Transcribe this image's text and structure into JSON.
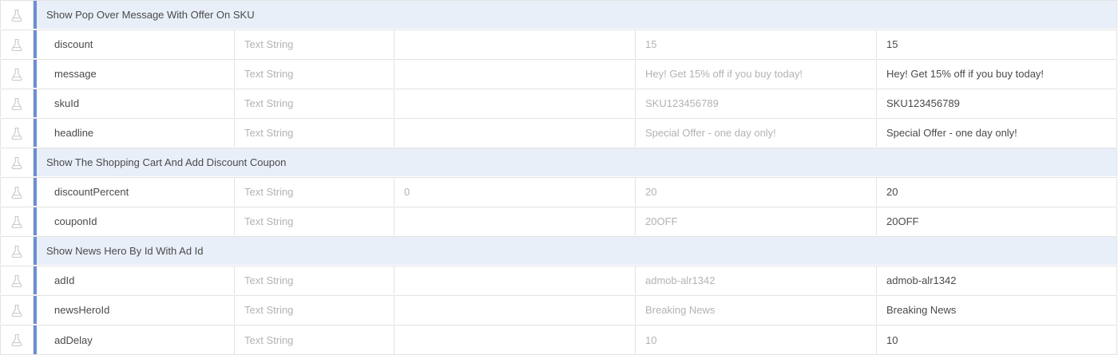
{
  "groups": [
    {
      "title": "Show Pop Over Message With Offer On SKU",
      "params": [
        {
          "name": "discount",
          "type": "Text String",
          "default": "",
          "placeholder": "15",
          "value": "15"
        },
        {
          "name": "message",
          "type": "Text String",
          "default": "",
          "placeholder": "Hey! Get 15% off if you buy today!",
          "value": "Hey! Get 15% off if you buy today!"
        },
        {
          "name": "skuId",
          "type": "Text String",
          "default": "",
          "placeholder": "SKU123456789",
          "value": "SKU123456789"
        },
        {
          "name": "headline",
          "type": "Text String",
          "default": "",
          "placeholder": "Special Offer - one day only!",
          "value": "Special Offer - one day only!"
        }
      ]
    },
    {
      "title": "Show The Shopping Cart And Add Discount Coupon",
      "params": [
        {
          "name": "discountPercent",
          "type": "Text String",
          "default": "0",
          "placeholder": "20",
          "value": "20"
        },
        {
          "name": "couponId",
          "type": "Text String",
          "default": "",
          "placeholder": "20OFF",
          "value": "20OFF"
        }
      ]
    },
    {
      "title": "Show News Hero By Id With Ad Id",
      "params": [
        {
          "name": "adId",
          "type": "Text String",
          "default": "",
          "placeholder": "admob-alr1342",
          "value": "admob-alr1342"
        },
        {
          "name": "newsHeroId",
          "type": "Text String",
          "default": "",
          "placeholder": "Breaking News",
          "value": "Breaking News"
        },
        {
          "name": "adDelay",
          "type": "Text String",
          "default": "",
          "placeholder": "10",
          "value": "10"
        }
      ]
    }
  ],
  "icons": {
    "row_icon": "flask-icon"
  },
  "colors": {
    "group_bg": "#e9eff9",
    "accent": "#6b8fd0",
    "border": "#e3e3e3",
    "muted_text": "#b3b3b3",
    "text": "#4a4a4a"
  }
}
